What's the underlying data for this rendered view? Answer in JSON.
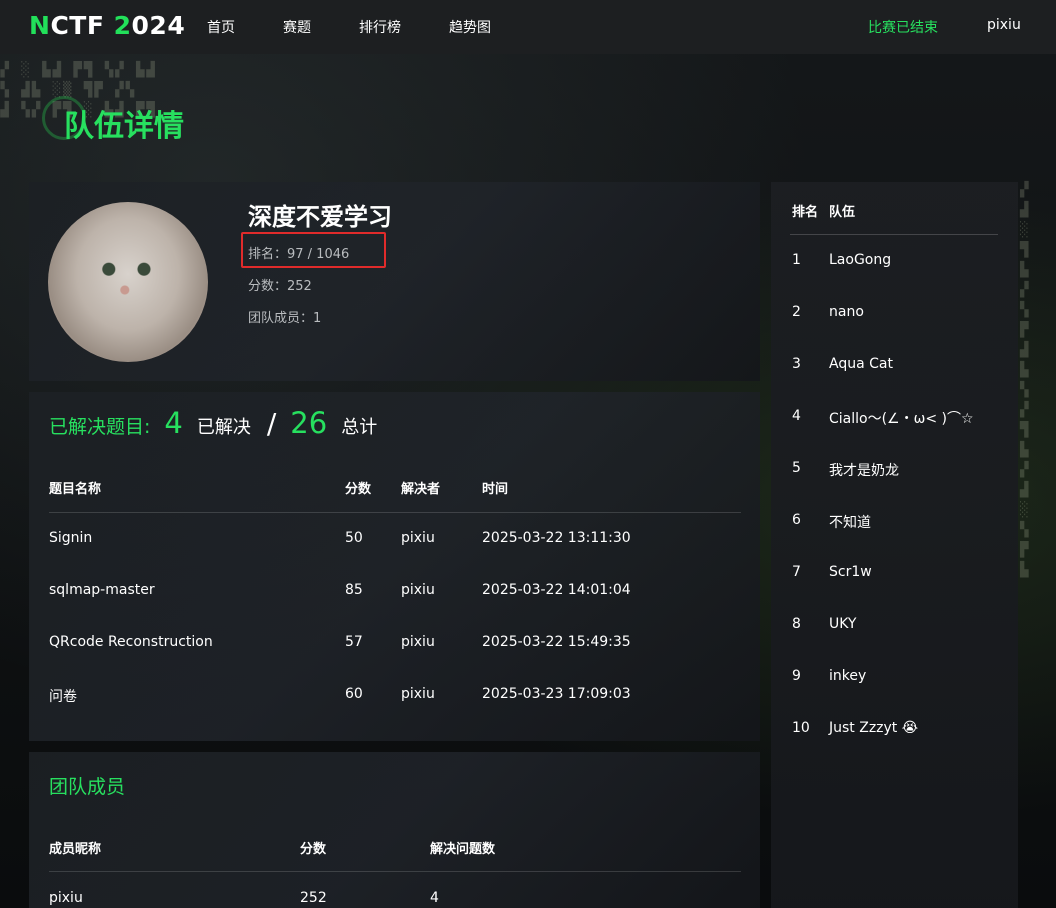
{
  "nav": {
    "brand_n": "N",
    "brand_ctf": "CTF ",
    "brand_2": "2",
    "brand_024": "024",
    "links": [
      "首页",
      "赛题",
      "排行榜",
      "趋势图"
    ],
    "status": "比赛已结束",
    "user": "pixiu"
  },
  "page_title": "队伍详情",
  "team": {
    "name": "深度不爱学习",
    "rank": "排名：97 / 1046",
    "score": "分数：252",
    "members": "团队成员：1"
  },
  "solved": {
    "label": "已解决题目:",
    "solved_count": "4",
    "solved_text": "已解决",
    "slash": "/",
    "total_count": "26",
    "total_text": "总计",
    "headers": [
      "题目名称",
      "分数",
      "解决者",
      "时间"
    ],
    "rows": [
      [
        "Signin",
        "50",
        "pixiu",
        "2025-03-22 13:11:30"
      ],
      [
        "sqlmap-master",
        "85",
        "pixiu",
        "2025-03-22 14:01:04"
      ],
      [
        "QRcode Reconstruction",
        "57",
        "pixiu",
        "2025-03-22 15:49:35"
      ],
      [
        "问卷",
        "60",
        "pixiu",
        "2025-03-23 17:09:03"
      ]
    ]
  },
  "members": {
    "title": "团队成员",
    "headers": [
      "成员昵称",
      "分数",
      "解决问题数"
    ],
    "rows": [
      [
        "pixiu",
        "252",
        "4"
      ]
    ]
  },
  "ranking": {
    "headers": [
      "排名",
      "队伍"
    ],
    "rows": [
      [
        "1",
        "LaoGong"
      ],
      [
        "2",
        "nano"
      ],
      [
        "3",
        "Aqua Cat"
      ],
      [
        "4",
        "Ciallo～(∠・ω< )⌒☆"
      ],
      [
        "5",
        "我才是奶龙"
      ],
      [
        "6",
        "不知道"
      ],
      [
        "7",
        "Scr1w"
      ],
      [
        "8",
        "UKY"
      ],
      [
        "9",
        "inkey"
      ],
      [
        "10",
        "Just Zzzyt 😭"
      ]
    ]
  },
  "colors": {
    "accent": "#27e05f",
    "highlight_box": "#e02b2b"
  }
}
